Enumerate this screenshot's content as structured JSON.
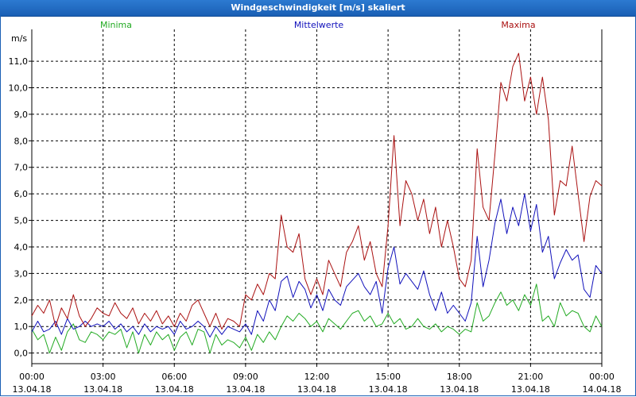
{
  "window": {
    "title": "Windgeschwindigkeit [m/s] skaliert"
  },
  "chart_data": {
    "type": "line",
    "title": "Windgeschwindigkeit [m/s] skaliert",
    "ylabel": "m/s",
    "ylim": [
      -0.4,
      12.2
    ],
    "yticks": [
      "0,0",
      "1,0",
      "2,0",
      "3,0",
      "4,0",
      "5,0",
      "6,0",
      "7,0",
      "8,0",
      "9,0",
      "10,0",
      "11,0"
    ],
    "x_tick_labels": [
      {
        "time": "00:00",
        "date": "13.04.18"
      },
      {
        "time": "03:00",
        "date": "13.04.18"
      },
      {
        "time": "06:00",
        "date": "13.04.18"
      },
      {
        "time": "09:00",
        "date": "13.04.18"
      },
      {
        "time": "12:00",
        "date": "13.04.18"
      },
      {
        "time": "15:00",
        "date": "13.04.18"
      },
      {
        "time": "18:00",
        "date": "13.04.18"
      },
      {
        "time": "21:00",
        "date": "13.04.18"
      },
      {
        "time": "00:00",
        "date": "14.04.18"
      }
    ],
    "xlim_hours": [
      0,
      24
    ],
    "grid": true,
    "legend_position": "top",
    "series": [
      {
        "name": "Minima",
        "color": "#22aa22",
        "points": [
          [
            0,
            0.9
          ],
          [
            0.25,
            0.5
          ],
          [
            0.5,
            0.7
          ],
          [
            0.75,
            0.0
          ],
          [
            1.0,
            0.6
          ],
          [
            1.25,
            0.1
          ],
          [
            1.5,
            0.8
          ],
          [
            1.75,
            1.1
          ],
          [
            2.0,
            0.5
          ],
          [
            2.25,
            0.4
          ],
          [
            2.5,
            0.8
          ],
          [
            2.75,
            0.7
          ],
          [
            3.0,
            0.5
          ],
          [
            3.25,
            0.8
          ],
          [
            3.5,
            0.7
          ],
          [
            3.75,
            0.9
          ],
          [
            4.0,
            0.2
          ],
          [
            4.25,
            0.8
          ],
          [
            4.5,
            0.0
          ],
          [
            4.75,
            0.7
          ],
          [
            5.0,
            0.3
          ],
          [
            5.25,
            0.8
          ],
          [
            5.5,
            0.5
          ],
          [
            5.75,
            0.7
          ],
          [
            6.0,
            0.1
          ],
          [
            6.25,
            0.6
          ],
          [
            6.5,
            0.8
          ],
          [
            6.75,
            0.3
          ],
          [
            7.0,
            0.9
          ],
          [
            7.25,
            0.8
          ],
          [
            7.5,
            0.0
          ],
          [
            7.75,
            0.7
          ],
          [
            8.0,
            0.3
          ],
          [
            8.25,
            0.5
          ],
          [
            8.5,
            0.4
          ],
          [
            8.75,
            0.2
          ],
          [
            9.0,
            0.6
          ],
          [
            9.25,
            0.1
          ],
          [
            9.5,
            0.7
          ],
          [
            9.75,
            0.4
          ],
          [
            10.0,
            0.8
          ],
          [
            10.25,
            0.5
          ],
          [
            10.5,
            1.0
          ],
          [
            10.75,
            1.4
          ],
          [
            11.0,
            1.2
          ],
          [
            11.25,
            1.5
          ],
          [
            11.5,
            1.3
          ],
          [
            11.75,
            1.0
          ],
          [
            12.0,
            1.2
          ],
          [
            12.25,
            0.8
          ],
          [
            12.5,
            1.3
          ],
          [
            12.75,
            1.1
          ],
          [
            13.0,
            0.9
          ],
          [
            13.25,
            1.2
          ],
          [
            13.5,
            1.5
          ],
          [
            13.75,
            1.6
          ],
          [
            14.0,
            1.2
          ],
          [
            14.25,
            1.4
          ],
          [
            14.5,
            1.0
          ],
          [
            14.75,
            1.1
          ],
          [
            15.0,
            1.5
          ],
          [
            15.25,
            1.1
          ],
          [
            15.5,
            1.3
          ],
          [
            15.75,
            0.9
          ],
          [
            16.0,
            1.0
          ],
          [
            16.25,
            1.3
          ],
          [
            16.5,
            1.0
          ],
          [
            16.75,
            0.9
          ],
          [
            17.0,
            1.1
          ],
          [
            17.25,
            0.8
          ],
          [
            17.5,
            1.0
          ],
          [
            17.75,
            0.9
          ],
          [
            18.0,
            0.7
          ],
          [
            18.25,
            0.9
          ],
          [
            18.5,
            0.8
          ],
          [
            18.75,
            1.9
          ],
          [
            19.0,
            1.2
          ],
          [
            19.25,
            1.4
          ],
          [
            19.5,
            1.9
          ],
          [
            19.75,
            2.3
          ],
          [
            20.0,
            1.8
          ],
          [
            20.25,
            2.0
          ],
          [
            20.5,
            1.6
          ],
          [
            20.75,
            2.2
          ],
          [
            21.0,
            1.8
          ],
          [
            21.25,
            2.6
          ],
          [
            21.5,
            1.2
          ],
          [
            21.75,
            1.4
          ],
          [
            22.0,
            1.0
          ],
          [
            22.25,
            1.9
          ],
          [
            22.5,
            1.4
          ],
          [
            22.75,
            1.6
          ],
          [
            23.0,
            1.5
          ],
          [
            23.25,
            1.0
          ],
          [
            23.5,
            0.8
          ],
          [
            23.75,
            1.4
          ],
          [
            24.0,
            1.0
          ]
        ]
      },
      {
        "name": "Mittelwerte",
        "color": "#1111bb",
        "points": [
          [
            0,
            0.8
          ],
          [
            0.25,
            1.2
          ],
          [
            0.5,
            0.8
          ],
          [
            0.75,
            0.9
          ],
          [
            1.0,
            1.2
          ],
          [
            1.25,
            0.7
          ],
          [
            1.5,
            1.3
          ],
          [
            1.75,
            0.9
          ],
          [
            2.0,
            1.0
          ],
          [
            2.25,
            1.2
          ],
          [
            2.5,
            1.0
          ],
          [
            2.75,
            1.1
          ],
          [
            3.0,
            1.0
          ],
          [
            3.25,
            1.2
          ],
          [
            3.5,
            0.9
          ],
          [
            3.75,
            1.1
          ],
          [
            4.0,
            0.8
          ],
          [
            4.25,
            1.0
          ],
          [
            4.5,
            0.7
          ],
          [
            4.75,
            1.1
          ],
          [
            5.0,
            0.8
          ],
          [
            5.25,
            1.0
          ],
          [
            5.5,
            0.9
          ],
          [
            5.75,
            1.0
          ],
          [
            6.0,
            0.7
          ],
          [
            6.25,
            1.2
          ],
          [
            6.5,
            0.9
          ],
          [
            6.75,
            1.0
          ],
          [
            7.0,
            1.2
          ],
          [
            7.25,
            1.0
          ],
          [
            7.5,
            0.6
          ],
          [
            7.75,
            1.0
          ],
          [
            8.0,
            0.7
          ],
          [
            8.25,
            1.0
          ],
          [
            8.5,
            0.9
          ],
          [
            8.75,
            0.8
          ],
          [
            9.0,
            1.1
          ],
          [
            9.25,
            0.7
          ],
          [
            9.5,
            1.6
          ],
          [
            9.75,
            1.2
          ],
          [
            10.0,
            2.0
          ],
          [
            10.25,
            1.6
          ],
          [
            10.5,
            2.7
          ],
          [
            10.75,
            2.9
          ],
          [
            11.0,
            2.1
          ],
          [
            11.25,
            2.7
          ],
          [
            11.5,
            2.4
          ],
          [
            11.75,
            1.7
          ],
          [
            12.0,
            2.2
          ],
          [
            12.25,
            1.6
          ],
          [
            12.5,
            2.4
          ],
          [
            12.75,
            2.0
          ],
          [
            13.0,
            1.8
          ],
          [
            13.25,
            2.5
          ],
          [
            13.75,
            3.0
          ],
          [
            14.0,
            2.5
          ],
          [
            14.25,
            2.2
          ],
          [
            14.5,
            2.7
          ],
          [
            14.75,
            1.5
          ],
          [
            15.0,
            3.2
          ],
          [
            15.25,
            4.0
          ],
          [
            15.5,
            2.6
          ],
          [
            15.75,
            3.0
          ],
          [
            16.0,
            2.7
          ],
          [
            16.25,
            2.4
          ],
          [
            16.5,
            3.1
          ],
          [
            16.75,
            2.2
          ],
          [
            17.0,
            1.6
          ],
          [
            17.25,
            2.3
          ],
          [
            17.5,
            1.5
          ],
          [
            17.75,
            1.8
          ],
          [
            18.0,
            1.5
          ],
          [
            18.25,
            1.2
          ],
          [
            18.5,
            1.9
          ],
          [
            18.75,
            4.4
          ],
          [
            19.0,
            2.5
          ],
          [
            19.25,
            3.5
          ],
          [
            19.5,
            4.9
          ],
          [
            19.75,
            5.8
          ],
          [
            20.0,
            4.5
          ],
          [
            20.25,
            5.5
          ],
          [
            20.5,
            4.8
          ],
          [
            20.75,
            6.0
          ],
          [
            21.0,
            4.6
          ],
          [
            21.25,
            5.6
          ],
          [
            21.5,
            3.8
          ],
          [
            21.75,
            4.4
          ],
          [
            22.0,
            2.8
          ],
          [
            22.25,
            3.4
          ],
          [
            22.5,
            3.9
          ],
          [
            22.75,
            3.5
          ],
          [
            23.0,
            3.7
          ],
          [
            23.25,
            2.4
          ],
          [
            23.5,
            2.1
          ],
          [
            23.75,
            3.3
          ],
          [
            24.0,
            3.0
          ]
        ]
      },
      {
        "name": "Maxima",
        "color": "#aa1111",
        "points": [
          [
            0,
            1.4
          ],
          [
            0.25,
            1.8
          ],
          [
            0.5,
            1.5
          ],
          [
            0.75,
            2.0
          ],
          [
            1.0,
            1.0
          ],
          [
            1.25,
            1.7
          ],
          [
            1.5,
            1.3
          ],
          [
            1.75,
            2.2
          ],
          [
            2.0,
            1.4
          ],
          [
            2.25,
            1.0
          ],
          [
            2.5,
            1.3
          ],
          [
            2.75,
            1.7
          ],
          [
            3.0,
            1.5
          ],
          [
            3.25,
            1.4
          ],
          [
            3.5,
            1.9
          ],
          [
            3.75,
            1.5
          ],
          [
            4.0,
            1.3
          ],
          [
            4.25,
            1.7
          ],
          [
            4.5,
            1.1
          ],
          [
            4.75,
            1.5
          ],
          [
            5.0,
            1.2
          ],
          [
            5.25,
            1.6
          ],
          [
            5.5,
            1.1
          ],
          [
            5.75,
            1.4
          ],
          [
            6.0,
            1.0
          ],
          [
            6.25,
            1.5
          ],
          [
            6.5,
            1.2
          ],
          [
            6.75,
            1.8
          ],
          [
            7.0,
            2.0
          ],
          [
            7.25,
            1.5
          ],
          [
            7.5,
            1.0
          ],
          [
            7.75,
            1.5
          ],
          [
            8.0,
            0.9
          ],
          [
            8.25,
            1.3
          ],
          [
            8.5,
            1.2
          ],
          [
            8.75,
            1.0
          ],
          [
            9.0,
            2.2
          ],
          [
            9.25,
            2.0
          ],
          [
            9.5,
            2.6
          ],
          [
            9.75,
            2.2
          ],
          [
            10.0,
            3.0
          ],
          [
            10.25,
            2.8
          ],
          [
            10.5,
            5.2
          ],
          [
            10.75,
            4.0
          ],
          [
            11.0,
            3.8
          ],
          [
            11.25,
            4.5
          ],
          [
            11.5,
            2.8
          ],
          [
            11.75,
            2.2
          ],
          [
            12.0,
            2.8
          ],
          [
            12.25,
            2.2
          ],
          [
            12.5,
            3.5
          ],
          [
            12.75,
            3.0
          ],
          [
            13.0,
            2.5
          ],
          [
            13.25,
            3.8
          ],
          [
            13.5,
            4.2
          ],
          [
            13.75,
            4.8
          ],
          [
            14.0,
            3.5
          ],
          [
            14.25,
            4.2
          ],
          [
            14.5,
            3.0
          ],
          [
            14.75,
            2.5
          ],
          [
            15.0,
            4.8
          ],
          [
            15.25,
            8.2
          ],
          [
            15.5,
            4.8
          ],
          [
            15.75,
            6.5
          ],
          [
            16.0,
            6.0
          ],
          [
            16.25,
            5.0
          ],
          [
            16.5,
            5.8
          ],
          [
            16.75,
            4.5
          ],
          [
            17.0,
            5.5
          ],
          [
            17.25,
            4.0
          ],
          [
            17.5,
            5.0
          ],
          [
            17.75,
            4.0
          ],
          [
            18.0,
            2.8
          ],
          [
            18.25,
            2.5
          ],
          [
            18.5,
            3.5
          ],
          [
            18.75,
            7.7
          ],
          [
            19.0,
            5.5
          ],
          [
            19.25,
            5.0
          ],
          [
            19.5,
            7.5
          ],
          [
            19.75,
            10.2
          ],
          [
            20.0,
            9.5
          ],
          [
            20.25,
            10.8
          ],
          [
            20.5,
            11.3
          ],
          [
            20.75,
            9.5
          ],
          [
            21.0,
            10.4
          ],
          [
            21.25,
            9.0
          ],
          [
            21.5,
            10.4
          ],
          [
            21.75,
            8.8
          ],
          [
            22.0,
            5.2
          ],
          [
            22.25,
            6.5
          ],
          [
            22.5,
            6.3
          ],
          [
            22.75,
            7.8
          ],
          [
            23.0,
            6.0
          ],
          [
            23.25,
            4.2
          ],
          [
            23.5,
            5.9
          ],
          [
            23.75,
            6.5
          ],
          [
            24.0,
            6.3
          ]
        ]
      }
    ]
  }
}
